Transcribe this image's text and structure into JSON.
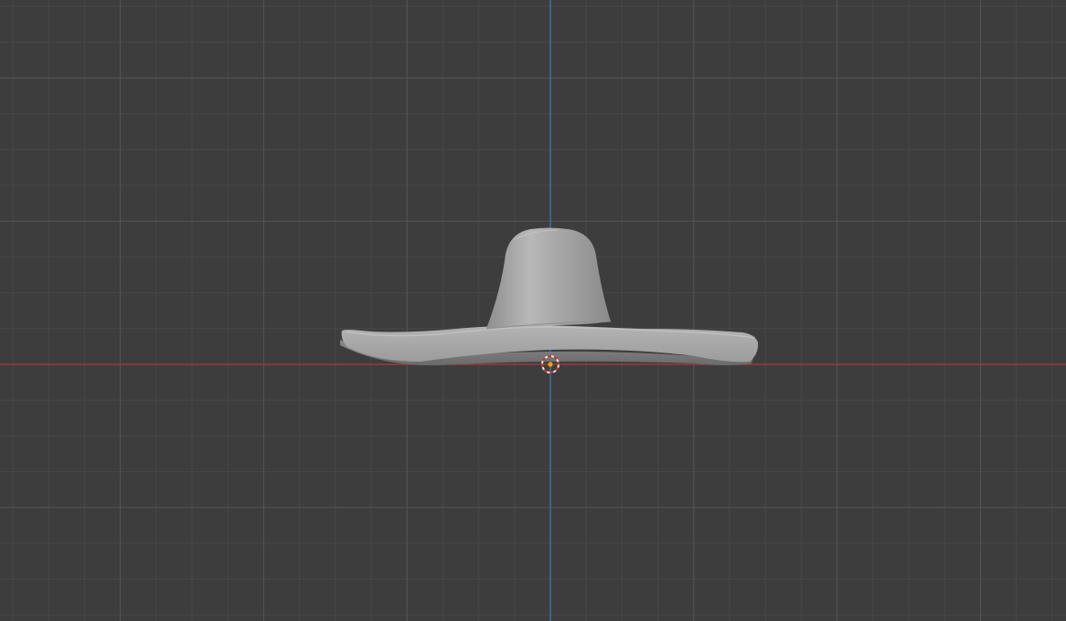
{
  "viewport": {
    "view": "front-orthographic",
    "background_color": "#3d3d3d",
    "grid_minor_color": "#484848",
    "grid_major_color": "#555555",
    "axis_x_color": "#9a3b40",
    "axis_z_color": "#3c6ea6",
    "grid_visible": true
  },
  "object": {
    "name_hint": "hat-mesh",
    "shading": "solid",
    "base_color": "#a6a6a6"
  },
  "cursor_3d": {
    "ring_colors": [
      "#e8e8e8",
      "#c0392b"
    ],
    "origin_dot_color": "#f2a010"
  }
}
